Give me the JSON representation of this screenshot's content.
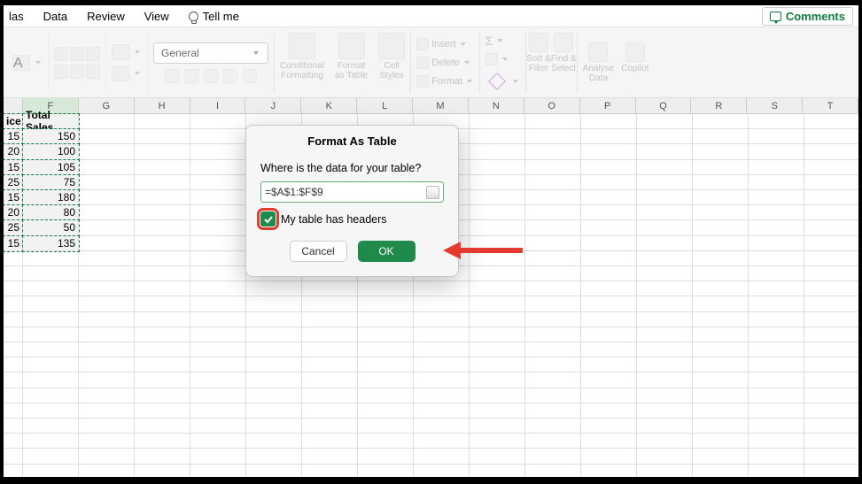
{
  "menubar": {
    "items": [
      "las",
      "Data",
      "Review",
      "View"
    ],
    "tellme": "Tell me"
  },
  "comments_label": "Comments",
  "ribbon": {
    "number_format": "General",
    "cond_fmt": "Conditional\nFormatting",
    "fmt_table": "Format\nas Table",
    "cell_styles": "Cell\nStyles",
    "insert": "Insert",
    "delete": "Delete",
    "format": "Format",
    "sort_filter": "Sort &\nFilter",
    "find_select": "Find &\nSelect",
    "analyse": "Analyse\nData",
    "copilot": "Copilot"
  },
  "columns": [
    "F",
    "G",
    "H",
    "I",
    "J",
    "K",
    "L",
    "M",
    "N",
    "O",
    "P",
    "Q",
    "R",
    "S",
    "T"
  ],
  "col_e_partial": "ice",
  "f_header": "Total Sales",
  "e_values": [
    "15",
    "20",
    "15",
    "25",
    "15",
    "20",
    "25",
    "15"
  ],
  "f_values": [
    "150",
    "100",
    "105",
    "75",
    "180",
    "80",
    "50",
    "135"
  ],
  "dialog": {
    "title": "Format As Table",
    "prompt": "Where is the data for your table?",
    "range": "=$A$1:$F$9",
    "headers_label": "My table has headers",
    "headers_checked": true,
    "cancel": "Cancel",
    "ok": "OK"
  }
}
